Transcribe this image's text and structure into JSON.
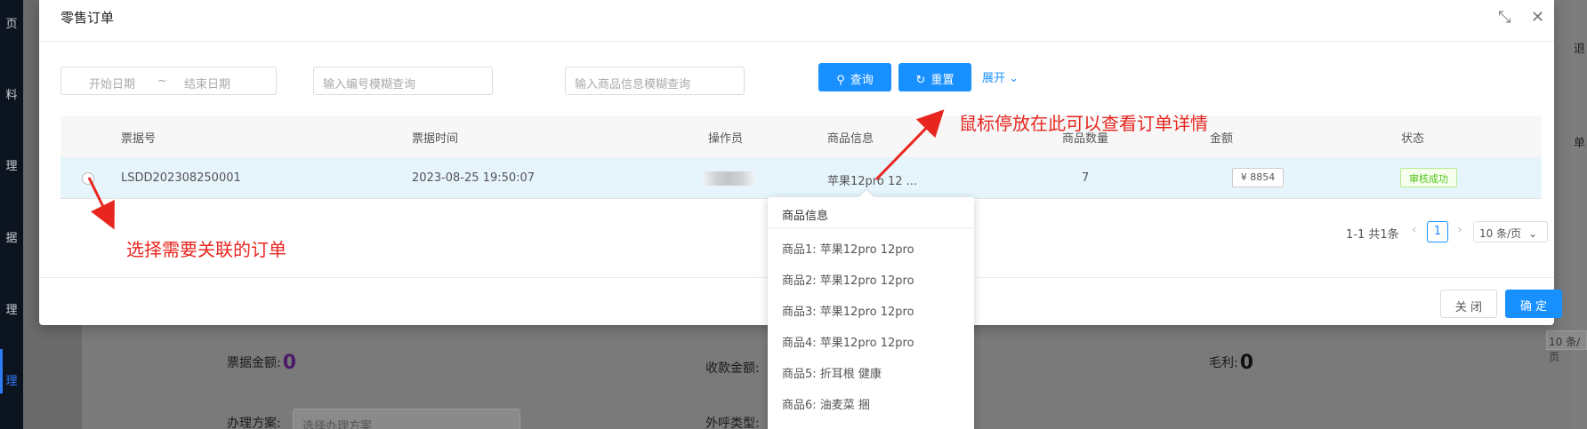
{
  "background": {
    "nav_fragments": [
      "页",
      "料",
      "理",
      "据",
      "理",
      "理"
    ],
    "active_nav": "理",
    "fields": [
      {
        "label": "票据金额:",
        "value": "0"
      },
      {
        "label": "收款金额:",
        "value": ""
      },
      {
        "label": "毛利:",
        "value": "0"
      },
      {
        "label": "办理方案:",
        "value": ""
      },
      {
        "label": "外呼类型:",
        "value": ""
      }
    ],
    "plan_select_placeholder": "选择办理方案",
    "right_fragments": [
      "退",
      "单"
    ],
    "right_page_size": "10 条/页"
  },
  "modal": {
    "title": "零售订单",
    "expand_icon": "fullscreen-icon",
    "close_icon": "close-icon",
    "filters": {
      "start_date_placeholder": "开始日期",
      "range_separator": "~",
      "end_date_placeholder": "结束日期",
      "number_placeholder": "输入编号模糊查询",
      "product_placeholder": "输入商品信息模糊查询",
      "search_label": "查询",
      "reset_label": "重置",
      "expand_label": "展开"
    },
    "table": {
      "columns": [
        "票据号",
        "票据时间",
        "操作员",
        "商品信息",
        "商品数量",
        "金额",
        "状态"
      ],
      "rows": [
        {
          "number": "LSDD202308250001",
          "time": "2023-08-25 19:50:07",
          "operator": "",
          "product": "苹果12pro 12 ...",
          "quantity": "7",
          "amount": "¥ 8854",
          "status": "审核成功"
        }
      ]
    },
    "pagination": {
      "total_text": "1-1 共1条",
      "current_page": "1",
      "page_size": "10 条/页"
    },
    "footer": {
      "close_label": "关 闭",
      "ok_label": "确 定"
    }
  },
  "popover": {
    "title": "商品信息",
    "items": [
      "商品1:  苹果12pro 12pro",
      "商品2:  苹果12pro 12pro",
      "商品3:  苹果12pro 12pro",
      "商品4:  苹果12pro 12pro",
      "商品5:  折耳根 健康",
      "商品6:  油麦菜 捆"
    ]
  },
  "annotations": {
    "hover_hint": "鼠标停放在此可以查看订单详情",
    "select_hint": "选择需要关联的订单",
    "color": "#e8261f"
  },
  "colors": {
    "primary": "#1890ff",
    "selected_row": "#e6f4fc",
    "success": "#52c41a"
  }
}
